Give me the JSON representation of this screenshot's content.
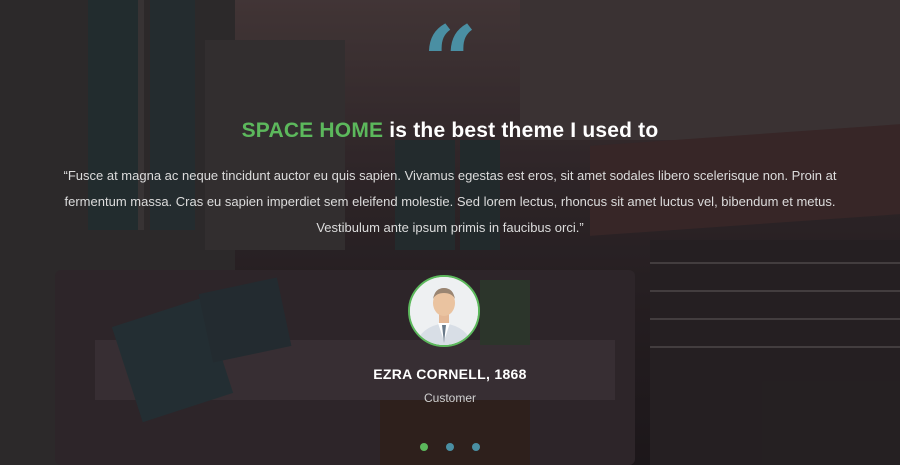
{
  "testimonial": {
    "quote_mark": "“",
    "headline_accent": "SPACE HOME",
    "headline_rest": " is the best theme I used to",
    "body": "“Fusce at magna ac neque tincidunt auctor eu quis sapien. Vivamus egestas est eros, sit amet sodales libero scelerisque non. Proin at fermentum massa. Cras eu sapien imperdiet sem eleifend molestie. Sed lorem lectus, rhoncus sit amet luctus vel, bibendum et metus. Vestibulum ante ipsum primis in faucibus orci.”",
    "author": "EZRA CORNELL, 1868",
    "role": "Customer",
    "avatar_icon": "person-portrait"
  },
  "slider": {
    "count": 3,
    "active_index": 0
  },
  "colors": {
    "accent_green": "#5cb85c",
    "accent_blue": "#4a8fa3",
    "text": "#ffffff"
  }
}
